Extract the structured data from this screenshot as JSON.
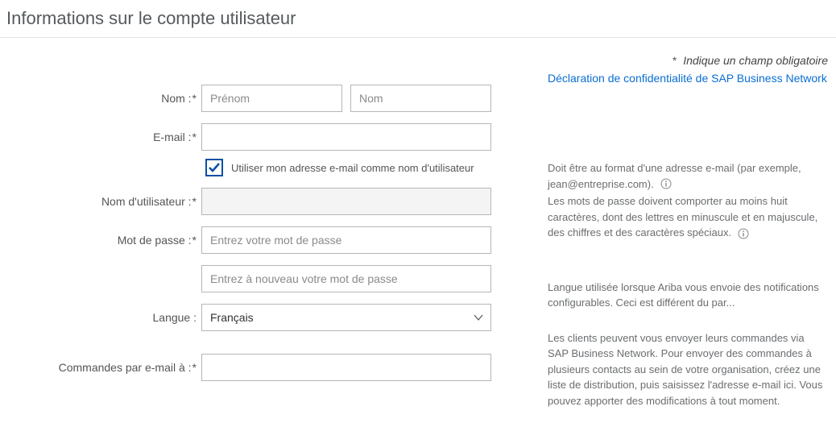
{
  "header": {
    "title": "Informations sur le compte utilisateur"
  },
  "required_note": {
    "asterisk": "*",
    "text": "Indique un champ obligatoire"
  },
  "privacy": {
    "label": "Déclaration de confidentialité de SAP Business Network"
  },
  "labels": {
    "name": "Nom :",
    "email": "E-mail :",
    "username": "Nom d'utilisateur :",
    "password": "Mot de passe :",
    "language": "Langue :",
    "orders_email": "Commandes par e-mail à :"
  },
  "asterisk": "*",
  "placeholders": {
    "first_name": "Prénom",
    "last_name": "Nom",
    "password": "Entrez votre mot de passe",
    "password_confirm": "Entrez à nouveau votre mot de passe"
  },
  "checkbox": {
    "use_email_as_user": "Utiliser mon adresse e-mail comme nom d'utilisateur",
    "checked": true
  },
  "language": {
    "selected": "Français",
    "options": [
      "Français"
    ]
  },
  "help": {
    "username": "Doit être au format d'une adresse e-mail (par exemple, jean@entreprise.com).",
    "password": "Les mots de passe doivent comporter au moins huit caractères, dont des lettres en minuscule et en majuscule, des chiffres et des caractères spéciaux.",
    "language": "Langue utilisée lorsque Ariba vous envoie des notifications configurables. Ceci est différent du par...",
    "orders_email": "Les clients peuvent vous envoyer leurs commandes via SAP Business Network. Pour envoyer des commandes à plusieurs contacts au sein de votre organisation, créez une liste de distribution, puis saisissez l'adresse e-mail ici. Vous pouvez apporter des modifications à tout moment."
  }
}
